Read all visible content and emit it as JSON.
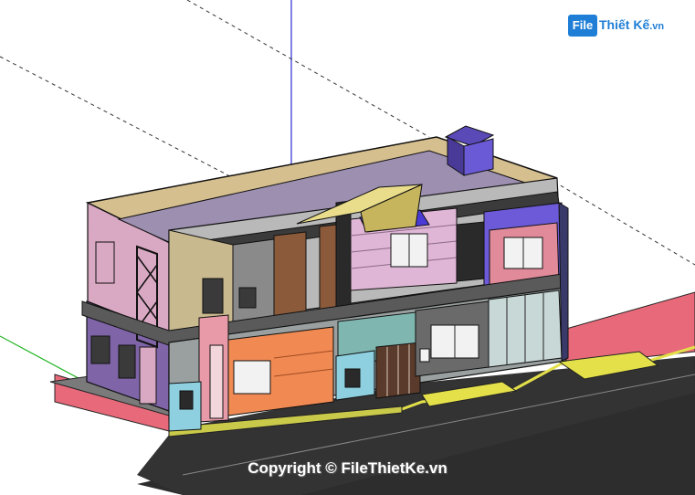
{
  "watermark": {
    "logo_badge": "File",
    "logo_text": "Thiết Kế",
    "logo_suffix": ".vn",
    "copyright": "Copyright © FileThietKe.vn"
  },
  "scene": {
    "description_tags": [
      "3d-model-viewport",
      "two-storey-house"
    ],
    "colors": {
      "background": "#ffffff",
      "axis_blue": "#2a2ad6",
      "axis_green": "#21b521",
      "axis_red": "#d62a2a",
      "road": "#2d2d2d",
      "sidewalk": "#e86a7a",
      "curb_yellow": "#e3e04a"
    }
  }
}
